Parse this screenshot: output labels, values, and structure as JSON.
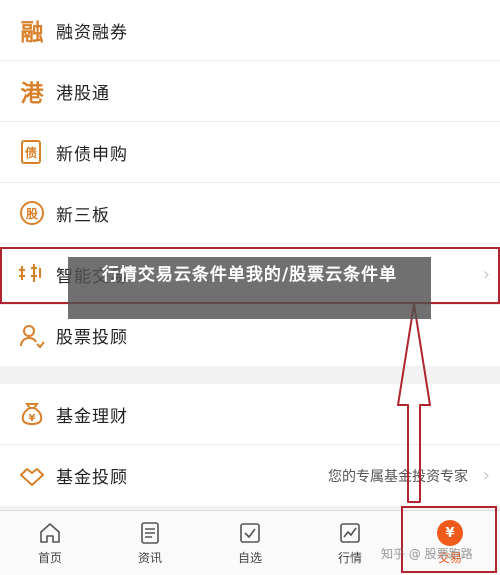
{
  "menu": [
    {
      "label": "融资融券",
      "icon": "rong-glyph-icon",
      "glyph": "融"
    },
    {
      "label": "港股通",
      "icon": "gang-glyph-icon",
      "glyph": "港"
    },
    {
      "label": "新债申购",
      "icon": "bond-doc-icon",
      "glyph": "债"
    },
    {
      "label": "新三板",
      "icon": "share-coin-icon",
      "glyph": "股"
    },
    {
      "label": "智能交易",
      "icon": "smart-trade-icon"
    },
    {
      "label": "股票投顾",
      "icon": "advisor-person-icon"
    }
  ],
  "menu2": [
    {
      "label": "基金理财",
      "icon": "money-bag-icon",
      "glyph": "¥"
    },
    {
      "label": "基金投顾",
      "icon": "handshake-icon",
      "subtitle": "您的专属基金投资专家"
    }
  ],
  "overlay_text": "行情交易云条件单我的/股票云条件单",
  "tabs": [
    {
      "label": "首页",
      "icon": "home-icon"
    },
    {
      "label": "资讯",
      "icon": "news-icon"
    },
    {
      "label": "自选",
      "icon": "watchlist-icon"
    },
    {
      "label": "行情",
      "icon": "chart-icon"
    },
    {
      "label": "交易",
      "icon": "yen-icon",
      "glyph": "¥"
    }
  ],
  "watermark": "知乎 @ 股票跑路",
  "colors": {
    "accent": "#d9812a",
    "highlight": "#b0242e",
    "active_tab": "#f05a1a"
  }
}
